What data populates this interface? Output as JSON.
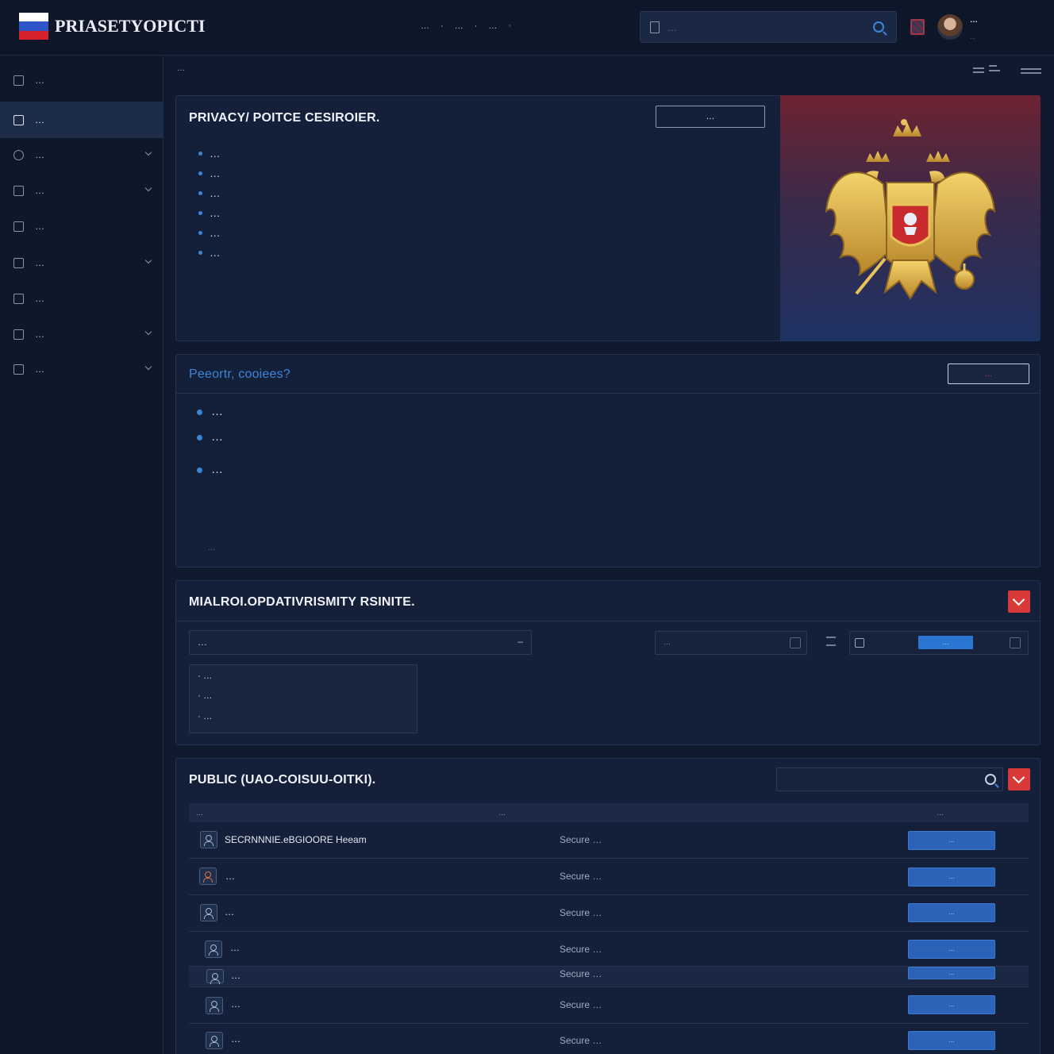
{
  "header": {
    "brand": "PRIASETYOPICTI",
    "flag_colors": [
      "#ffffff",
      "#2d55c8",
      "#d8222b"
    ],
    "nav": [
      "…",
      "…",
      "…"
    ],
    "search_placeholder": "…",
    "user_name": "…",
    "user_role": "…"
  },
  "sidebar": {
    "items": [
      {
        "label": "…",
        "icon": "dashboard-icon",
        "active": false,
        "expandable": false
      },
      {
        "label": "…",
        "icon": "document-icon",
        "active": true,
        "expandable": false
      },
      {
        "label": "…",
        "icon": "shield-icon",
        "active": false,
        "expandable": true
      },
      {
        "label": "…",
        "icon": "report-icon",
        "active": false,
        "expandable": true
      },
      {
        "label": "…",
        "icon": "file-icon",
        "active": false,
        "expandable": false
      },
      {
        "label": "…",
        "icon": "archive-icon",
        "active": false,
        "expandable": true
      },
      {
        "label": "…",
        "icon": "server-icon",
        "active": false,
        "expandable": false
      },
      {
        "label": "…",
        "icon": "lock-icon",
        "active": false,
        "expandable": true
      },
      {
        "label": "…",
        "icon": "clipboard-icon",
        "active": false,
        "expandable": true
      }
    ]
  },
  "breadcrumb": "…",
  "privacy_panel": {
    "title": "PRIVACY/ POITCE CESIROIER.",
    "button": "…",
    "bullets": [
      "…",
      "…",
      "…",
      "…",
      "…",
      "…"
    ]
  },
  "cookies_panel": {
    "title": "Peeortr, cooiees?",
    "button": "…",
    "bullets": [
      "…",
      "…",
      "…"
    ],
    "link": "…"
  },
  "sensitivity_panel": {
    "title": "MIALROI.OPDATIVRISMITY RSINITE.",
    "select_value": "…",
    "field_placeholder": "…",
    "chip_label": "…",
    "options": [
      "…",
      "…",
      "…"
    ]
  },
  "public_panel": {
    "title": "PUBLIC (UAO-COISUU-OITKI).",
    "search_placeholder": "",
    "columns": [
      "…",
      "…",
      "…"
    ],
    "rows": [
      {
        "name": "SECRNNNIE.eBGIOORE Heeam",
        "log": "Secure …",
        "action": "…",
        "icon_style": "blue"
      },
      {
        "name": "…",
        "log": "Secure …",
        "action": "…",
        "icon_style": "orange"
      },
      {
        "name": "…",
        "log": "Secure …",
        "action": "…",
        "icon_style": "blue"
      },
      {
        "name": "…",
        "log": "Secure …",
        "action": "…",
        "icon_style": "blue"
      },
      {
        "name": "…",
        "log": "Secure …",
        "action": "…",
        "icon_style": "blue"
      },
      {
        "name": "…",
        "log": "Secure …",
        "action": "…",
        "icon_style": "blue"
      },
      {
        "name": "…",
        "log": "Secure …",
        "action": "…",
        "icon_style": "blue"
      }
    ]
  },
  "colors": {
    "accent": "#3a86d8",
    "danger": "#d83a3a",
    "bg": "#0f1a2e",
    "panel": "#14203a"
  }
}
